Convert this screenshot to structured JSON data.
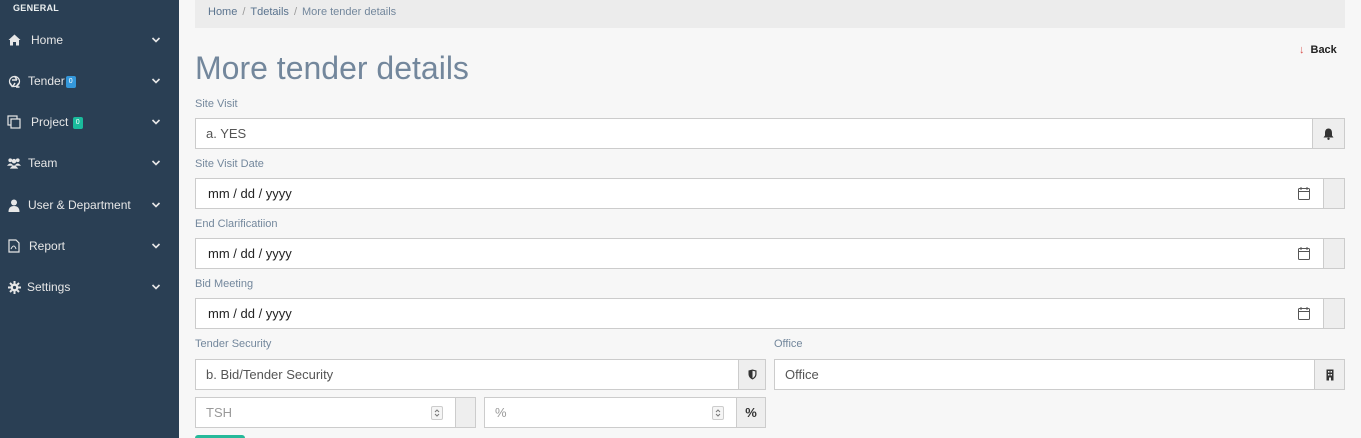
{
  "sidebar": {
    "section": "GENERAL",
    "items": [
      {
        "label": "Home",
        "icon": "home-icon"
      },
      {
        "label": "Tender",
        "icon": "recycle-icon",
        "badge": "0",
        "badge_color": "#3498db"
      },
      {
        "label": "Project",
        "icon": "clone-icon",
        "badge": "0",
        "badge_color": "#1abb9c"
      },
      {
        "label": "Team",
        "icon": "users-icon"
      },
      {
        "label": "User & Department",
        "icon": "user-icon"
      },
      {
        "label": "Report",
        "icon": "file-pdf-icon"
      },
      {
        "label": "Settings",
        "icon": "gear-icon"
      }
    ]
  },
  "breadcrumb": {
    "home": "Home",
    "tdetails": "Tdetails",
    "current": "More tender details",
    "sep": "/"
  },
  "page": {
    "title": "More tender details",
    "back": "Back"
  },
  "form": {
    "site_visit": {
      "label": "Site Visit",
      "value": "a. YES"
    },
    "site_visit_date": {
      "label": "Site Visit Date",
      "value": "mm / dd / yyyy"
    },
    "end_clarification": {
      "label": "End Clarificatiion",
      "value": "mm / dd / yyyy"
    },
    "bid_meeting": {
      "label": "Bid Meeting",
      "value": "mm / dd / yyyy"
    },
    "tender_security": {
      "label": "Tender Security",
      "value": "b. Bid/Tender Security"
    },
    "office": {
      "label": "Office",
      "value": "Office"
    },
    "amount": {
      "placeholder": "TSH"
    },
    "percent": {
      "placeholder": "%",
      "addon": "%"
    }
  }
}
